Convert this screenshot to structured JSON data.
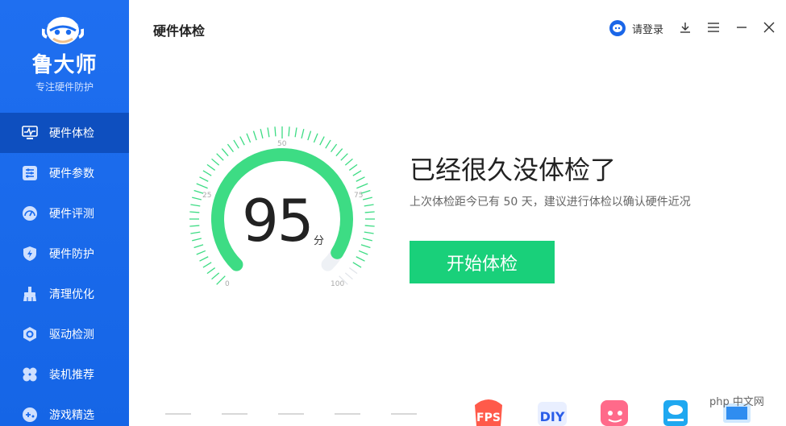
{
  "brand": {
    "name": "鲁大师",
    "tagline": "专注硬件防护"
  },
  "sidebar": {
    "items": [
      {
        "label": "硬件体检",
        "icon": "monitor-pulse-icon"
      },
      {
        "label": "硬件参数",
        "icon": "sliders-icon"
      },
      {
        "label": "硬件评测",
        "icon": "speedometer-icon"
      },
      {
        "label": "硬件防护",
        "icon": "shield-bolt-icon"
      },
      {
        "label": "清理优化",
        "icon": "broom-icon"
      },
      {
        "label": "驱动检测",
        "icon": "hexagon-gear-icon"
      },
      {
        "label": "装机推荐",
        "icon": "four-leaf-icon"
      },
      {
        "label": "游戏精选",
        "icon": "gamepad-icon"
      }
    ],
    "active_index": 0
  },
  "header": {
    "title": "硬件体检",
    "login_label": "请登录"
  },
  "gauge": {
    "score": "95",
    "unit": "分",
    "value": 95,
    "max": 100,
    "ticks": {
      "t0": "0",
      "t25": "25",
      "t50": "50",
      "t75": "75",
      "t100": "100"
    }
  },
  "message": {
    "headline": "已经很久没体检了",
    "detail": "上次体检距今已有 50 天，建议进行体检以确认硬件近况"
  },
  "actions": {
    "start_label": "开始体检"
  },
  "bottom": {
    "tools": [
      "fps-icon",
      "diy-icon",
      "game-app-icon",
      "drive-icon",
      "display-icon"
    ],
    "watermark": "php 中文网"
  },
  "colors": {
    "sidebar": "#1a6cf0",
    "active": "#0e4fbf",
    "accent_green": "#19d07a",
    "gauge_green": "#3ddc84"
  }
}
